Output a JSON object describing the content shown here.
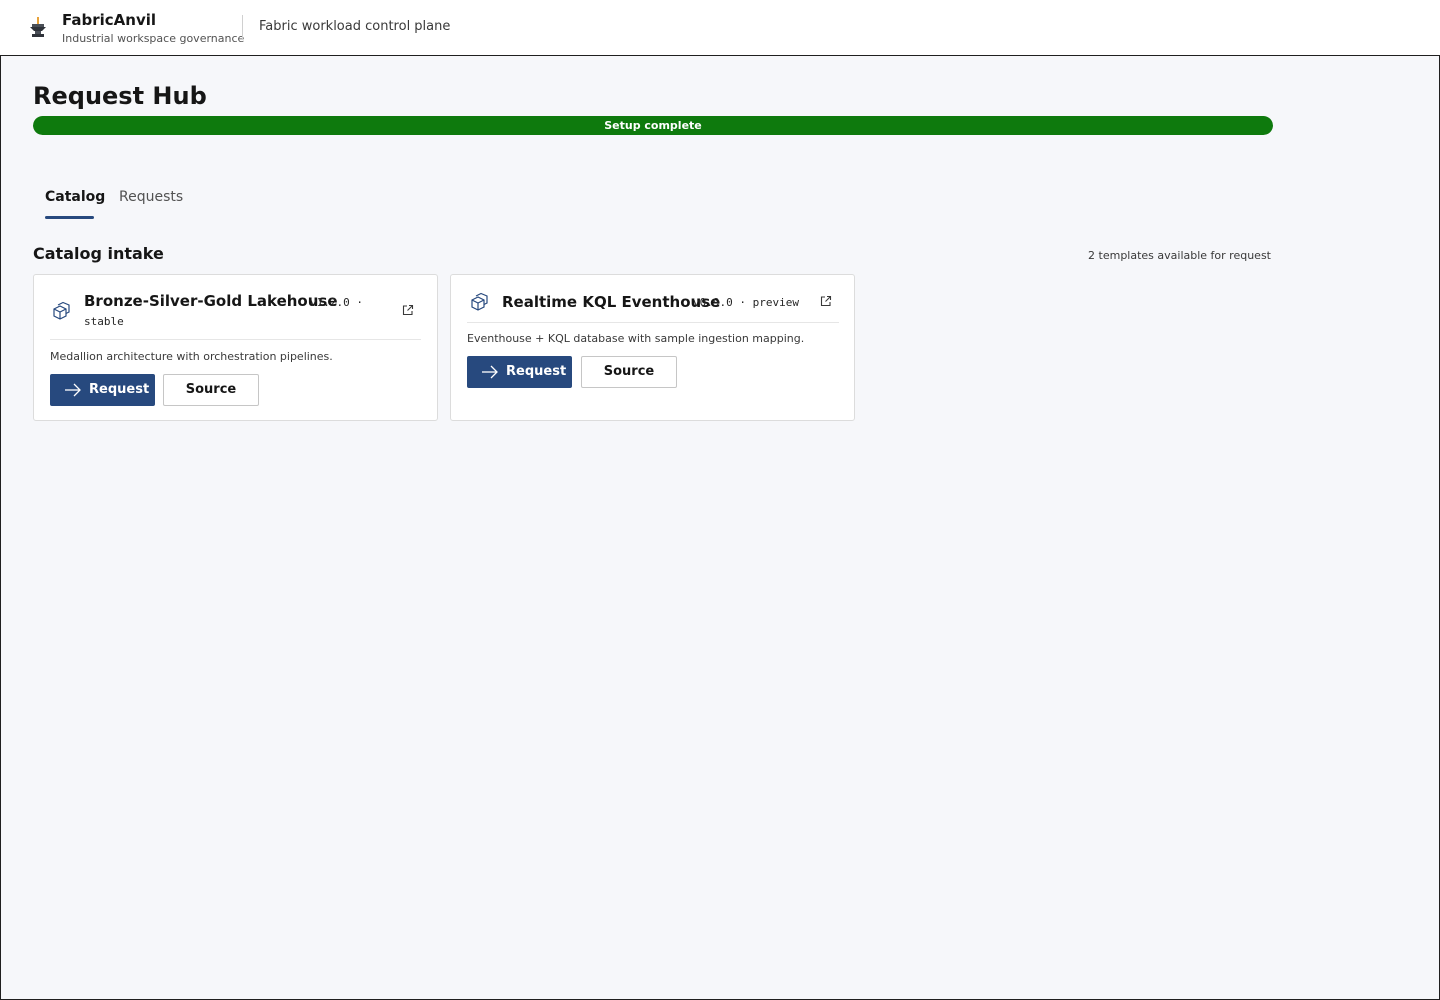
{
  "header": {
    "brand_name": "FabricAnvil",
    "brand_subtitle": "Industrial workspace governance",
    "tagline": "Fabric workload control plane"
  },
  "page": {
    "title": "Request Hub",
    "progress": {
      "label": "Setup complete",
      "percent": 100,
      "color": "#0e7a0d"
    }
  },
  "tabs": [
    {
      "label": "Catalog",
      "active": true
    },
    {
      "label": "Requests",
      "active": false
    }
  ],
  "catalog": {
    "title": "Catalog intake",
    "count_text": "2 templates available for request",
    "cards": [
      {
        "title": "Bronze-Silver-Gold Lakehouse",
        "version": "v1.2.0 ·",
        "channel": "stable",
        "description": "Medallion architecture with orchestration pipelines.",
        "request_label": "Request",
        "source_label": "Source"
      },
      {
        "title": "Realtime KQL Eventhouse",
        "version": "v0.9.0 · preview",
        "channel": "",
        "description": "Eventhouse + KQL database with sample ingestion mapping.",
        "request_label": "Request",
        "source_label": "Source"
      }
    ]
  },
  "colors": {
    "accent": "#27497e",
    "success": "#0e7a0d",
    "background": "#f6f7fa"
  },
  "icons": {
    "logo": "anvil-icon",
    "card": "cube-stack-icon",
    "external": "external-link-icon",
    "request": "arrow-right-icon"
  }
}
